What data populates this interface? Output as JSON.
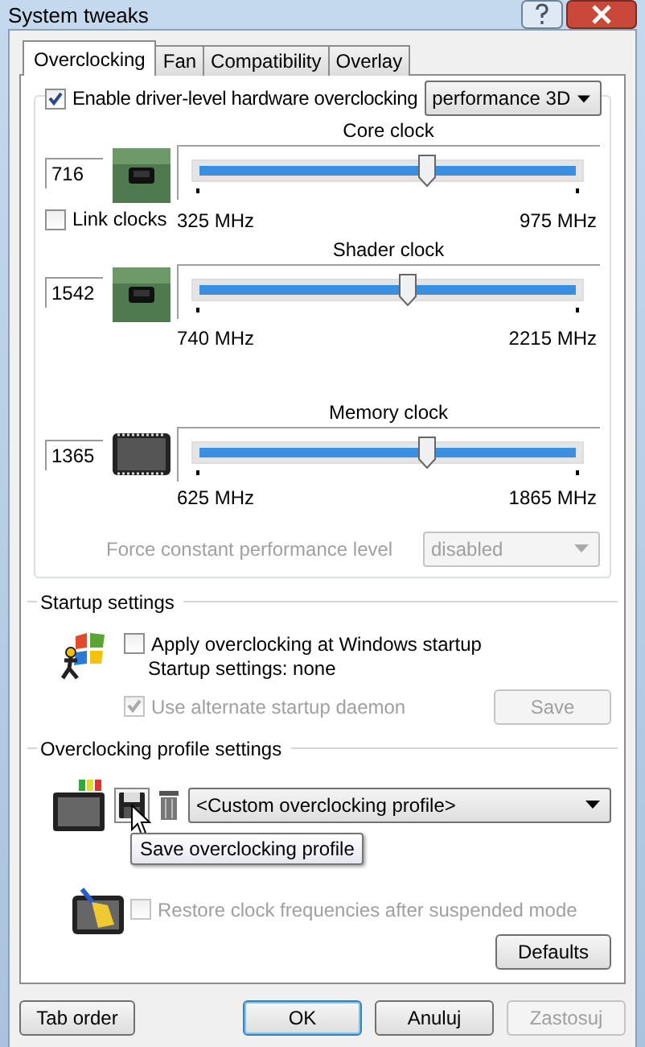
{
  "window": {
    "title": "System tweaks"
  },
  "tabs": [
    {
      "label": "Overclocking",
      "selected": true
    },
    {
      "label": "Fan",
      "selected": false
    },
    {
      "label": "Compatibility",
      "selected": false
    },
    {
      "label": "Overlay",
      "selected": false
    }
  ],
  "overclocking": {
    "enable": {
      "label": "Enable driver-level hardware overclocking",
      "checked": true
    },
    "mode": "performance 3D",
    "link_clocks": {
      "label": "Link clocks",
      "checked": false
    },
    "clocks": [
      {
        "kind": "core",
        "title": "Core clock",
        "value": "716",
        "min": "325 MHz",
        "max": "975 MHz",
        "level": 0.6
      },
      {
        "kind": "shader",
        "title": "Shader clock",
        "value": "1542",
        "min": "740 MHz",
        "max": "2215 MHz",
        "level": 0.55
      },
      {
        "kind": "memory",
        "title": "Memory clock",
        "value": "1365",
        "min": "625 MHz",
        "max": "1865 MHz",
        "level": 0.6
      }
    ],
    "force_constant": {
      "label": "Force constant performance level",
      "value": "disabled",
      "disabled": true
    }
  },
  "startup": {
    "title": "Startup settings",
    "apply": {
      "label": "Apply overclocking at Windows startup",
      "checked": false
    },
    "status": "Startup settings: none",
    "daemon": {
      "label": "Use alternate startup daemon",
      "checked": true,
      "disabled": true
    },
    "save_button": {
      "label": "Save",
      "disabled": true
    }
  },
  "profiles": {
    "title": "Overclocking profile settings",
    "profile": "<Custom overclocking profile>",
    "tooltip": "Save overclocking profile"
  },
  "restore": {
    "label": "Restore clock frequencies after suspended mode",
    "checked": false,
    "disabled": true
  },
  "defaults_button": "Defaults",
  "buttons": [
    {
      "label": "Tab order",
      "default": false,
      "disabled": false
    },
    {
      "label": "OK",
      "default": true,
      "disabled": false
    },
    {
      "label": "Anuluj",
      "default": false,
      "disabled": false
    },
    {
      "label": "Zastosuj",
      "default": false,
      "disabled": true
    }
  ]
}
